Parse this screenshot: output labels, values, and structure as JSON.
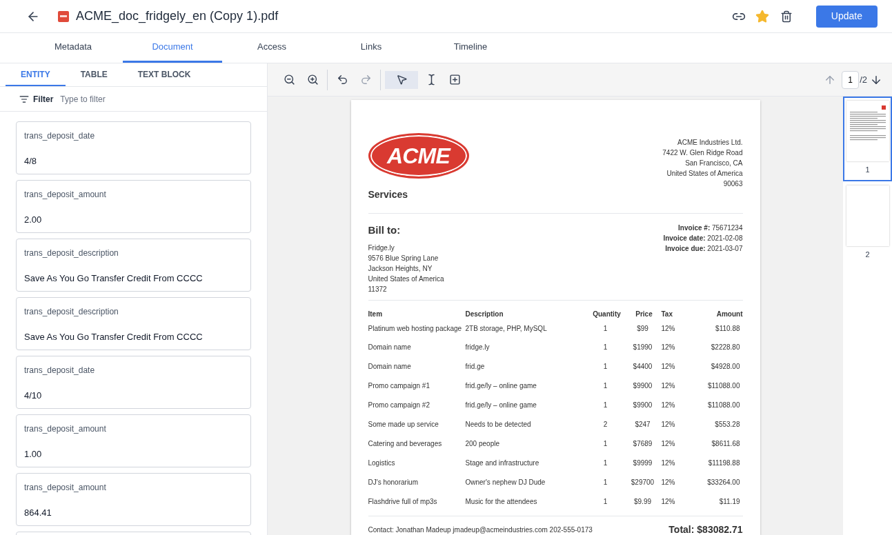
{
  "header": {
    "file_title": "ACME_doc_fridgely_en (Copy 1).pdf",
    "starred": true,
    "update_button": "Update"
  },
  "tabs": [
    {
      "label": "Metadata",
      "selected": false
    },
    {
      "label": "Document",
      "selected": true
    },
    {
      "label": "Access",
      "selected": false
    },
    {
      "label": "Links",
      "selected": false
    },
    {
      "label": "Timeline",
      "selected": false
    }
  ],
  "subtabs": [
    {
      "label": "ENTITY",
      "selected": true
    },
    {
      "label": "TABLE",
      "selected": false
    },
    {
      "label": "TEXT BLOCK",
      "selected": false
    }
  ],
  "filter": {
    "label": "Filter",
    "placeholder": "Type to filter"
  },
  "entities": [
    {
      "name": "trans_deposit_date",
      "value": "4/8"
    },
    {
      "name": "trans_deposit_amount",
      "value": "2.00"
    },
    {
      "name": "trans_deposit_description",
      "value": "Save As You Go Transfer Credit From CCCC"
    },
    {
      "name": "trans_deposit_description",
      "value": "Save As You Go Transfer Credit From CCCC"
    },
    {
      "name": "trans_deposit_date",
      "value": "4/10"
    },
    {
      "name": "trans_deposit_amount",
      "value": "1.00"
    },
    {
      "name": "trans_deposit_amount",
      "value": "864.41"
    }
  ],
  "toolbar": {
    "tools": [
      {
        "kind": "zoom-out",
        "disabled": false,
        "selected": false
      },
      {
        "kind": "zoom-in",
        "disabled": false,
        "selected": false
      },
      {
        "kind": "undo",
        "disabled": false,
        "selected": false
      },
      {
        "kind": "redo",
        "disabled": true,
        "selected": false
      },
      {
        "kind": "pointer",
        "disabled": false,
        "selected": true
      },
      {
        "kind": "text-select",
        "disabled": false,
        "selected": false
      },
      {
        "kind": "area-select",
        "disabled": false,
        "selected": false
      }
    ],
    "page_number": "1",
    "page_total": "/2"
  },
  "invoice": {
    "logo_text": "ACME",
    "subtitle": "Services",
    "company_address": [
      "ACME Industries Ltd.",
      "7422 W. Glen Ridge Road",
      "San Francisco, CA",
      "United States of America",
      "90063"
    ],
    "bill_to_heading": "Bill to:",
    "bill_to": [
      "Fridge.ly",
      "9576 Blue Spring Lane",
      "Jackson Heights, NY",
      "United States of America",
      "11372"
    ],
    "invoice_info": [
      "**Invoice #:** 75671234",
      "**Invoice date:** 2021-02-08",
      "**Invoice due:** 2021-03-07"
    ],
    "columns": [
      "Item",
      "Description",
      "Quantity",
      "Price",
      "Tax",
      "Amount"
    ],
    "rows": [
      [
        "Platinum web hosting package",
        "2TB storage, PHP, MySQL",
        "1",
        "$99",
        "12%",
        "$110.88"
      ],
      [
        "Domain name",
        "fridge.ly",
        "1",
        "$1990",
        "12%",
        "$2228.80"
      ],
      [
        "Domain name",
        "frid.ge",
        "1",
        "$4400",
        "12%",
        "$4928.00"
      ],
      [
        "Promo campaign #1",
        "frid.ge/ly – online game",
        "1",
        "$9900",
        "12%",
        "$11088.00"
      ],
      [
        "Promo campaign #2",
        "frid.ge/ly – online game",
        "1",
        "$9900",
        "12%",
        "$11088.00"
      ],
      [
        "Some made up service",
        "Needs to be detected",
        "2",
        "$247",
        "12%",
        "$553.28"
      ],
      [
        "Catering and beverages",
        "200 people",
        "1",
        "$7689",
        "12%",
        "$8611.68"
      ],
      [
        "Logistics",
        "Stage and infrastructure",
        "1",
        "$9999",
        "12%",
        "$11198.88"
      ],
      [
        "DJ's honorarium",
        "Owner's nephew DJ Dude",
        "1",
        "$29700",
        "12%",
        "$33264.00"
      ],
      [
        "Flashdrive full of mp3s",
        "Music for the attendees",
        "1",
        "$9.99",
        "12%",
        "$11.19"
      ]
    ],
    "contact": "Contact: Jonathan Madeup jmadeup@acmeindustries.com 202-555-0173",
    "total": "Total: $83082.71"
  },
  "thumbnails": [
    {
      "label": "1",
      "selected": true
    },
    {
      "label": "2",
      "selected": false
    }
  ]
}
